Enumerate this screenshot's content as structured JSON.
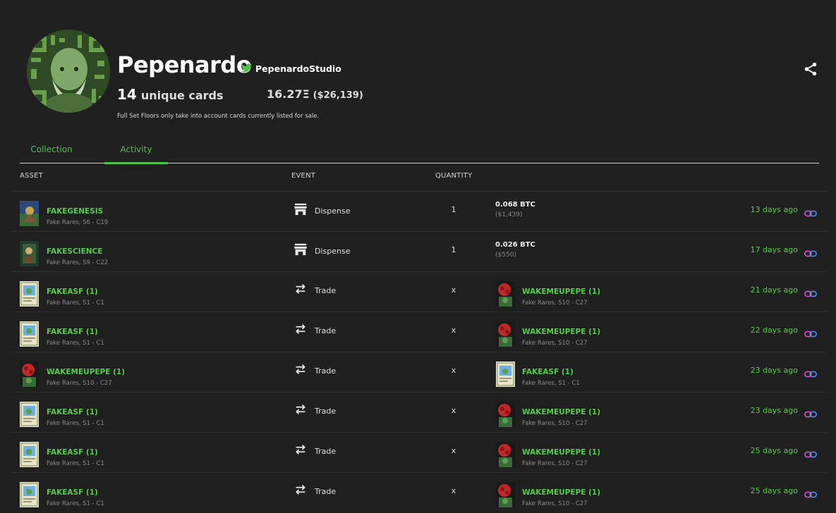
{
  "profile": {
    "name": "Pepenardo",
    "twitter_handle": "PepenardoStudio",
    "unique_count": "14",
    "unique_label": "unique cards",
    "value_eth": "16.27Ξ",
    "value_usd": "($26,139)",
    "note": "Full Set Floors only take into account cards currently listed for sale."
  },
  "tabs": {
    "collection": "Collection",
    "activity": "Activity",
    "active": "Activity"
  },
  "table": {
    "headers": {
      "asset": "ASSET",
      "event": "EVENT",
      "quantity": "QUANTITY"
    },
    "rows": [
      {
        "asset": {
          "name": "FAKEGENESIS",
          "sub": "Fake Rares, S6 - C19"
        },
        "event": "Dispense",
        "qty": "1",
        "price": {
          "btc": "0.068 BTC",
          "usd": "($1,439)"
        },
        "time": "13 days ago"
      },
      {
        "asset": {
          "name": "FAKESCIENCE",
          "sub": "Fake Rares, S9 - C22"
        },
        "event": "Dispense",
        "qty": "1",
        "price": {
          "btc": "0.026 BTC",
          "usd": "($550)"
        },
        "time": "17 days ago"
      },
      {
        "asset": {
          "name": "FAKEASF (1)",
          "sub": "Fake Rares, S1 - C1"
        },
        "event": "Trade",
        "qty": "x",
        "counter": {
          "name": "WAKEMEUPEPE (1)",
          "sub": "Fake Rares, S10 - C27"
        },
        "time": "21 days ago"
      },
      {
        "asset": {
          "name": "FAKEASF (1)",
          "sub": "Fake Rares, S1 - C1"
        },
        "event": "Trade",
        "qty": "x",
        "counter": {
          "name": "WAKEMEUPEPE (1)",
          "sub": "Fake Rares, S10 - C27"
        },
        "time": "22 days ago"
      },
      {
        "asset": {
          "name": "WAKEMEUPEPE (1)",
          "sub": "Fake Rares, S10 - C27"
        },
        "event": "Trade",
        "qty": "x",
        "counter": {
          "name": "FAKEASF (1)",
          "sub": "Fake Rares, S1 - C1"
        },
        "time": "23 days ago"
      },
      {
        "asset": {
          "name": "FAKEASF (1)",
          "sub": "Fake Rares, S1 - C1"
        },
        "event": "Trade",
        "qty": "x",
        "counter": {
          "name": "WAKEMEUPEPE (1)",
          "sub": "Fake Rares, S10 - C27"
        },
        "time": "23 days ago"
      },
      {
        "asset": {
          "name": "FAKEASF (1)",
          "sub": "Fake Rares, S1 - C1"
        },
        "event": "Trade",
        "qty": "x",
        "counter": {
          "name": "WAKEMEUPEPE (1)",
          "sub": "Fake Rares, S10 - C27"
        },
        "time": "25 days ago"
      },
      {
        "asset": {
          "name": "FAKEASF (1)",
          "sub": "Fake Rares, S1 - C1"
        },
        "event": "Trade",
        "qty": "x",
        "counter": {
          "name": "WAKEMEUPEPE (1)",
          "sub": "Fake Rares, S10 - C27"
        },
        "time": "25 days ago"
      }
    ]
  },
  "colors": {
    "accent": "#5ac94f",
    "background": "#202020",
    "twitter": "#4ec24b",
    "link_pink": "#d94fd1",
    "link_blue": "#4f8fe8"
  },
  "icons": {
    "twitter": "twitter-icon",
    "share": "share-icon",
    "dispense": "store-icon",
    "trade": "swap-arrows-icon",
    "link": "chain-link-icon"
  }
}
